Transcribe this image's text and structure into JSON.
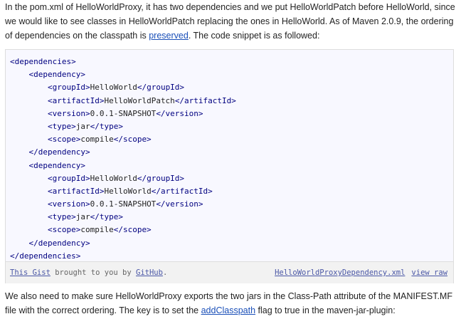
{
  "intro": {
    "before_link": "In the pom.xml of HelloWorldProxy, it has two dependencies and we put HelloWorldPatch before HelloWorld, since we would like to see classes in HelloWorldPatch replacing the ones in HelloWorld. As of Maven 2.0.9, the ordering of dependencies on the classpath is ",
    "link": "preserved",
    "after_link": ". The code snippet is as followed:"
  },
  "code_lines": [
    {
      "indent": "",
      "open": "<dependencies>",
      "text": "",
      "close": ""
    },
    {
      "indent": "    ",
      "open": "<dependency>",
      "text": "",
      "close": ""
    },
    {
      "indent": "        ",
      "open": "<groupId>",
      "text": "HelloWorld",
      "close": "</groupId>"
    },
    {
      "indent": "        ",
      "open": "<artifactId>",
      "text": "HelloWorldPatch",
      "close": "</artifactId>"
    },
    {
      "indent": "        ",
      "open": "<version>",
      "text": "0.0.1-SNAPSHOT",
      "close": "</version>"
    },
    {
      "indent": "        ",
      "open": "<type>",
      "text": "jar",
      "close": "</type>"
    },
    {
      "indent": "        ",
      "open": "<scope>",
      "text": "compile",
      "close": "</scope>"
    },
    {
      "indent": "    ",
      "open": "</dependency>",
      "text": "",
      "close": ""
    },
    {
      "indent": "    ",
      "open": "<dependency>",
      "text": "",
      "close": ""
    },
    {
      "indent": "        ",
      "open": "<groupId>",
      "text": "HelloWorld",
      "close": "</groupId>"
    },
    {
      "indent": "        ",
      "open": "<artifactId>",
      "text": "HelloWorld",
      "close": "</artifactId>"
    },
    {
      "indent": "        ",
      "open": "<version>",
      "text": "0.0.1-SNAPSHOT",
      "close": "</version>"
    },
    {
      "indent": "        ",
      "open": "<type>",
      "text": "jar",
      "close": "</type>"
    },
    {
      "indent": "        ",
      "open": "<scope>",
      "text": "compile",
      "close": "</scope>"
    },
    {
      "indent": "    ",
      "open": "</dependency>",
      "text": "",
      "close": ""
    },
    {
      "indent": "",
      "open": "</dependencies>",
      "text": "",
      "close": ""
    }
  ],
  "gist_meta": {
    "this_gist_link": "This Gist",
    "brought_text": " brought to you by ",
    "github_link": "GitHub",
    "period": ".",
    "filename_link": "HelloWorldProxyDependency.xml",
    "view_raw_link": "view raw"
  },
  "outro": {
    "before_link": "We also need to make sure HelloWorldProxy exports the two jars in the Class-Path attribute of the MANIFEST.MF file with the correct ordering. The key is to set the ",
    "link": "addClasspath",
    "after_link": " flag to true in the maven-jar-plugin:"
  },
  "colors": {
    "link": "#1a4fb8",
    "code_tag": "#000080",
    "code_bg": "#f8f8ff",
    "meta_bg": "#f2f2f2"
  }
}
